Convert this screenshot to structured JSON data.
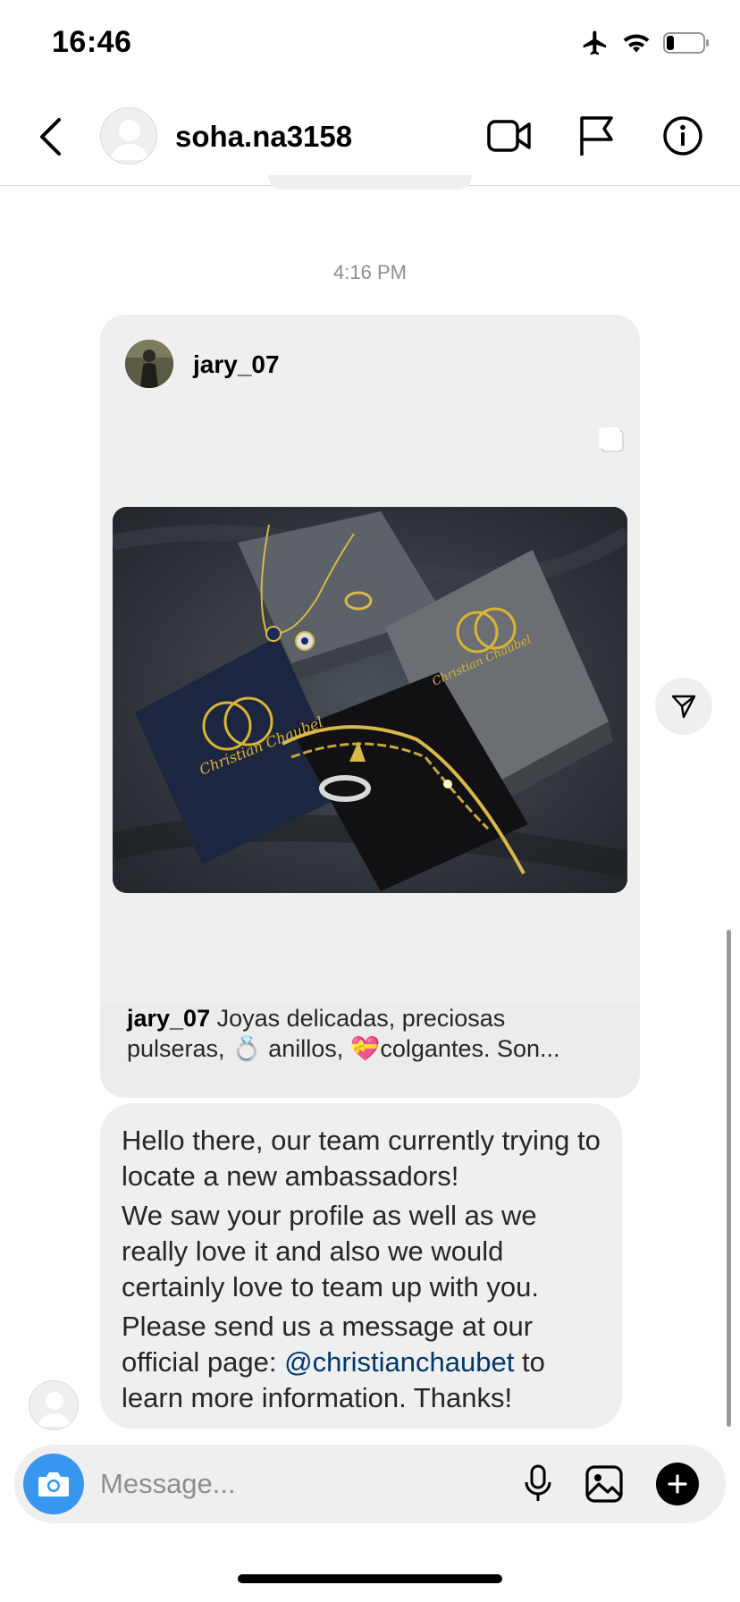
{
  "status_bar": {
    "time": "16:46",
    "icons": [
      "airplane-icon",
      "wifi-icon",
      "battery-icon"
    ],
    "battery_level": 0.2
  },
  "header": {
    "username": "soha.na3158",
    "icons": [
      "back-chevron-icon",
      "video-call-icon",
      "flag-icon",
      "info-icon"
    ]
  },
  "conversation": {
    "timestamp": "4:16 PM",
    "shared_post": {
      "author": "jary_07",
      "caption_author": "jary_07",
      "caption_line1": " Joyas delicadas, preciosas",
      "caption_line2_a": "pulseras, ",
      "caption_emoji_ring": "💍",
      "caption_line2_b": " anillos, ",
      "caption_emoji_heart": "💝",
      "caption_line2_c": "colgantes. Son..."
    },
    "message": {
      "para1": "Hello there, our  team  currently trying to  locate a new ambassadors!",
      "para2": "We saw your profile  as well as we really love it  and also we  would certainly love to  team up with you.",
      "para3_before": "Please send us a message at our official  page:  ",
      "link": "@christianchaubet",
      "para3_after": " to learn more  information. Thanks!"
    }
  },
  "composer": {
    "placeholder": "Message...",
    "icons": [
      "camera-icon",
      "microphone-icon",
      "gallery-icon",
      "plus-icon"
    ]
  },
  "colors": {
    "accent": "#3797f0",
    "link": "#00376b",
    "bubble": "#efefef",
    "secondary_text": "#8e8e8e"
  }
}
